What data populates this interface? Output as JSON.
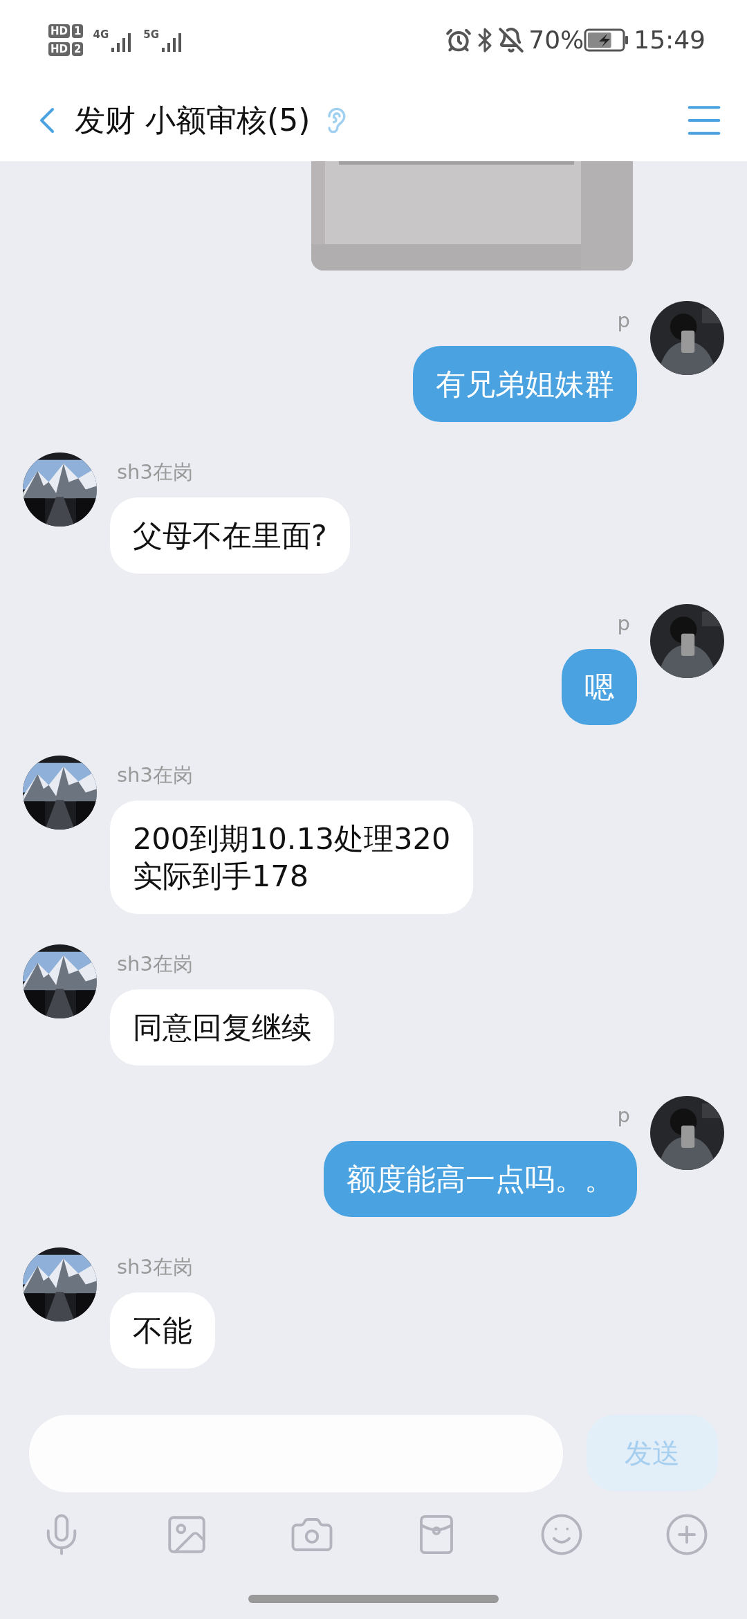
{
  "status_bar": {
    "sims": [
      {
        "tag": "HD",
        "slot": "1"
      },
      {
        "tag": "HD",
        "slot": "2"
      }
    ],
    "networks": [
      "4G",
      "5G"
    ],
    "battery": "70%",
    "time": "15:49"
  },
  "header": {
    "title": "发财 小额审核(5)"
  },
  "messages": [
    {
      "kind": "sent_image"
    },
    {
      "kind": "sent",
      "sender": "p",
      "text": "有兄弟姐妹群"
    },
    {
      "kind": "received",
      "sender": "sh3在岗",
      "text": "父母不在里面?"
    },
    {
      "kind": "sent",
      "sender": "p",
      "text": "嗯"
    },
    {
      "kind": "received",
      "sender": "sh3在岗",
      "text": "200到期10.13处理320\n实际到手178"
    },
    {
      "kind": "received",
      "sender": "sh3在岗",
      "text": "同意回复继续"
    },
    {
      "kind": "sent",
      "sender": "p",
      "text": "额度能高一点吗。。"
    },
    {
      "kind": "received",
      "sender": "sh3在岗",
      "text": "不能"
    }
  ],
  "composer": {
    "send": "发送"
  }
}
